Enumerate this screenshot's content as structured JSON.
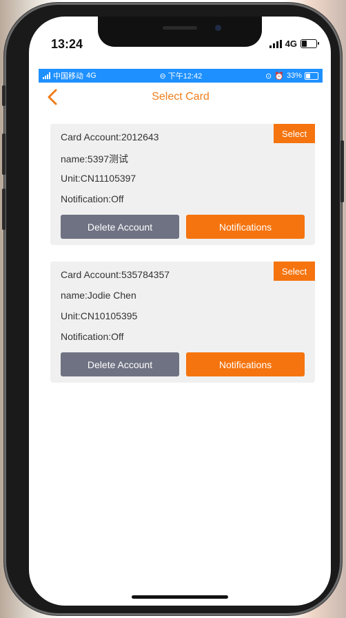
{
  "ios_status": {
    "time": "13:24",
    "network": "4G"
  },
  "android_status": {
    "carrier": "中国移动",
    "network": "4G",
    "time": "下午12:42",
    "battery": "33%"
  },
  "nav": {
    "title": "Select Card",
    "back_icon": "chevron-left-icon"
  },
  "colors": {
    "accent": "#f5740f",
    "title": "#f07d1a",
    "delete": "#6f7282",
    "card_bg": "#f0f0f0",
    "android_bar": "#1e90ff"
  },
  "cards": [
    {
      "account": "Card Account:2012643",
      "name": "name:5397测试",
      "unit": "Unit:CN11105397",
      "notification": "Notification:Off",
      "select_label": "Select",
      "delete_label": "Delete Account",
      "notifications_label": "Notifications"
    },
    {
      "account": "Card Account:535784357",
      "name": "name:Jodie Chen",
      "unit": "Unit:CN10105395",
      "notification": "Notification:Off",
      "select_label": "Select",
      "delete_label": "Delete Account",
      "notifications_label": "Notifications"
    }
  ]
}
